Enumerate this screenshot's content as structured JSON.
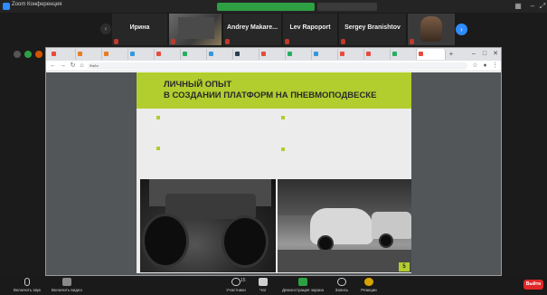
{
  "zoom": {
    "window_title": "Zoom Конференция",
    "share_banner": "",
    "view_options_label": ""
  },
  "participants": [
    {
      "name": "Ирина",
      "muted": true
    },
    {
      "name": "",
      "muted": true
    },
    {
      "name": "Andrey Makare...",
      "muted": true
    },
    {
      "name": "Lev Rapoport",
      "muted": true
    },
    {
      "name": "Sergey Branishtov",
      "muted": true
    },
    {
      "name": "",
      "muted": true
    }
  ],
  "browser": {
    "tabs": [
      {
        "label": "",
        "color": "#e74c3c"
      },
      {
        "label": "",
        "color": "#e67e22"
      },
      {
        "label": "",
        "color": "#e67e22"
      },
      {
        "label": "",
        "color": "#3498db"
      },
      {
        "label": "",
        "color": "#e74c3c"
      },
      {
        "label": "",
        "color": "#27ae60"
      },
      {
        "label": "",
        "color": "#3498db"
      },
      {
        "label": "",
        "color": "#2c3e50"
      },
      {
        "label": "",
        "color": "#e74c3c"
      },
      {
        "label": "",
        "color": "#27ae60"
      },
      {
        "label": "",
        "color": "#3498db"
      },
      {
        "label": "",
        "color": "#e74c3c"
      },
      {
        "label": "",
        "color": "#e74c3c"
      },
      {
        "label": "",
        "color": "#27ae60"
      },
      {
        "label": "",
        "color": "#e74c3c"
      }
    ],
    "url_label": "Файл",
    "url": ""
  },
  "slide": {
    "title_line1": "ЛИЧНЫЙ ОПЫТ",
    "title_line2": "В СОЗДАНИИ ПЛАТФОРМ НА ПНЕВМОПОДВЕСКЕ",
    "bullets": [
      {
        "text": ""
      },
      {
        "text": ""
      },
      {
        "text": ""
      }
    ],
    "highlight": "",
    "page_number": "5",
    "accent_color": "#b2cd2e"
  },
  "toolbar": {
    "items": [
      {
        "label": "Включить звук",
        "icon": "mic-muted-icon"
      },
      {
        "label": "Включить видео",
        "icon": "video-off-icon"
      },
      {
        "label": "Участники",
        "icon": "participants-icon",
        "count": "15"
      },
      {
        "label": "Чат",
        "icon": "chat-icon"
      },
      {
        "label": "Демонстрация экрана",
        "icon": "share-screen-icon"
      },
      {
        "label": "Запись",
        "icon": "record-icon"
      },
      {
        "label": "Реакции",
        "icon": "reactions-icon"
      }
    ],
    "end_label": "Выйти"
  }
}
